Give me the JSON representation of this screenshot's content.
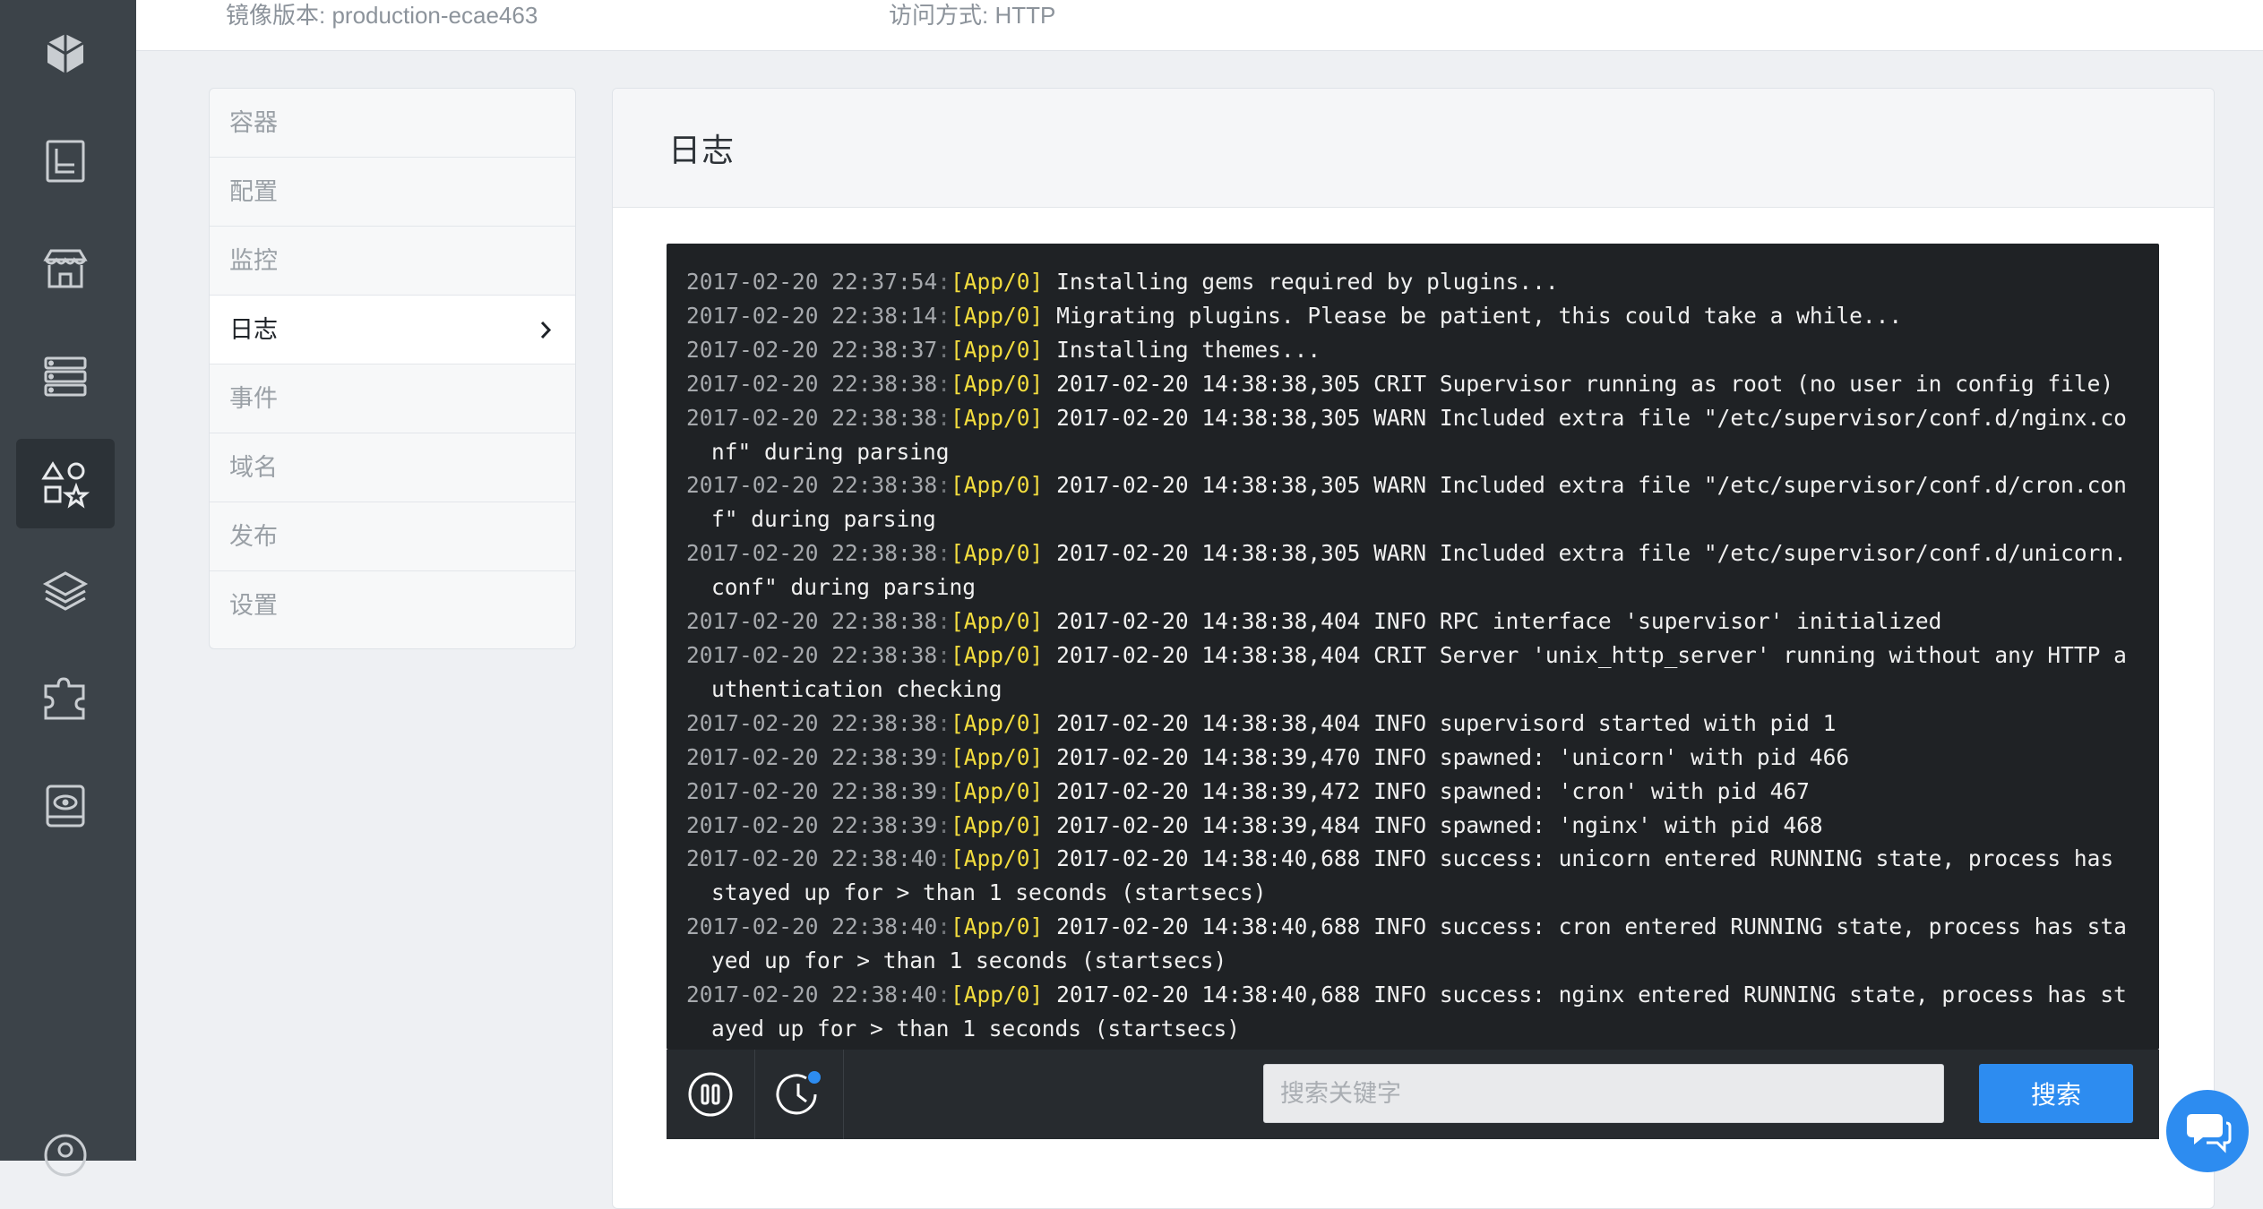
{
  "topbar": {
    "image_version_label": "镜像版本:",
    "image_version_value": "production-ecae463",
    "access_label": "访问方式:",
    "access_value": "HTTP"
  },
  "rail": {
    "icons": [
      "logo-icon",
      "document-icon",
      "store-icon",
      "servers-icon",
      "apps-icon",
      "layers-icon",
      "puzzle-icon",
      "disk-icon",
      "user-icon"
    ],
    "active": "apps-icon"
  },
  "subnav": {
    "items": [
      {
        "label": "容器"
      },
      {
        "label": "配置"
      },
      {
        "label": "监控"
      },
      {
        "label": "日志",
        "active": true
      },
      {
        "label": "事件"
      },
      {
        "label": "域名"
      },
      {
        "label": "发布"
      },
      {
        "label": "设置"
      }
    ]
  },
  "panel": {
    "title": "日志"
  },
  "logs": [
    {
      "ts": "2017-02-20 22:37:54",
      "app": "[App/0]",
      "msg": "Installing gems required by plugins..."
    },
    {
      "ts": "2017-02-20 22:38:14",
      "app": "[App/0]",
      "msg": "Migrating plugins. Please be patient, this could take a while..."
    },
    {
      "ts": "2017-02-20 22:38:37",
      "app": "[App/0]",
      "msg": "Installing themes..."
    },
    {
      "ts": "2017-02-20 22:38:38",
      "app": "[App/0]",
      "msg": "2017-02-20 14:38:38,305 CRIT Supervisor running as root (no user in config file)"
    },
    {
      "ts": "2017-02-20 22:38:38",
      "app": "[App/0]",
      "msg": "2017-02-20 14:38:38,305 WARN Included extra file \"/etc/supervisor/conf.d/nginx.conf\" during parsing"
    },
    {
      "ts": "2017-02-20 22:38:38",
      "app": "[App/0]",
      "msg": "2017-02-20 14:38:38,305 WARN Included extra file \"/etc/supervisor/conf.d/cron.conf\" during parsing"
    },
    {
      "ts": "2017-02-20 22:38:38",
      "app": "[App/0]",
      "msg": "2017-02-20 14:38:38,305 WARN Included extra file \"/etc/supervisor/conf.d/unicorn.conf\" during parsing"
    },
    {
      "ts": "2017-02-20 22:38:38",
      "app": "[App/0]",
      "msg": "2017-02-20 14:38:38,404 INFO RPC interface 'supervisor' initialized"
    },
    {
      "ts": "2017-02-20 22:38:38",
      "app": "[App/0]",
      "msg": "2017-02-20 14:38:38,404 CRIT Server 'unix_http_server' running without any HTTP authentication checking"
    },
    {
      "ts": "2017-02-20 22:38:38",
      "app": "[App/0]",
      "msg": "2017-02-20 14:38:38,404 INFO supervisord started with pid 1"
    },
    {
      "ts": "2017-02-20 22:38:39",
      "app": "[App/0]",
      "msg": "2017-02-20 14:38:39,470 INFO spawned: 'unicorn' with pid 466"
    },
    {
      "ts": "2017-02-20 22:38:39",
      "app": "[App/0]",
      "msg": "2017-02-20 14:38:39,472 INFO spawned: 'cron' with pid 467"
    },
    {
      "ts": "2017-02-20 22:38:39",
      "app": "[App/0]",
      "msg": "2017-02-20 14:38:39,484 INFO spawned: 'nginx' with pid 468"
    },
    {
      "ts": "2017-02-20 22:38:40",
      "app": "[App/0]",
      "msg": "2017-02-20 14:38:40,688 INFO success: unicorn entered RUNNING state, process has stayed up for > than 1 seconds (startsecs)"
    },
    {
      "ts": "2017-02-20 22:38:40",
      "app": "[App/0]",
      "msg": "2017-02-20 14:38:40,688 INFO success: cron entered RUNNING state, process has stayed up for > than 1 seconds (startsecs)"
    },
    {
      "ts": "2017-02-20 22:38:40",
      "app": "[App/0]",
      "msg": "2017-02-20 14:38:40,688 INFO success: nginx entered RUNNING state, process has stayed up for > than 1 seconds (startsecs)"
    }
  ],
  "controls": {
    "pause_icon": "pause-icon",
    "history_icon": "clock-icon",
    "search_placeholder": "搜索关键字",
    "search_button": "搜索"
  },
  "colors": {
    "rail_bg": "#3c4349",
    "terminal_bg": "#1f2225",
    "app_tag": "#f3dd3e",
    "accent": "#2d8cf0"
  }
}
